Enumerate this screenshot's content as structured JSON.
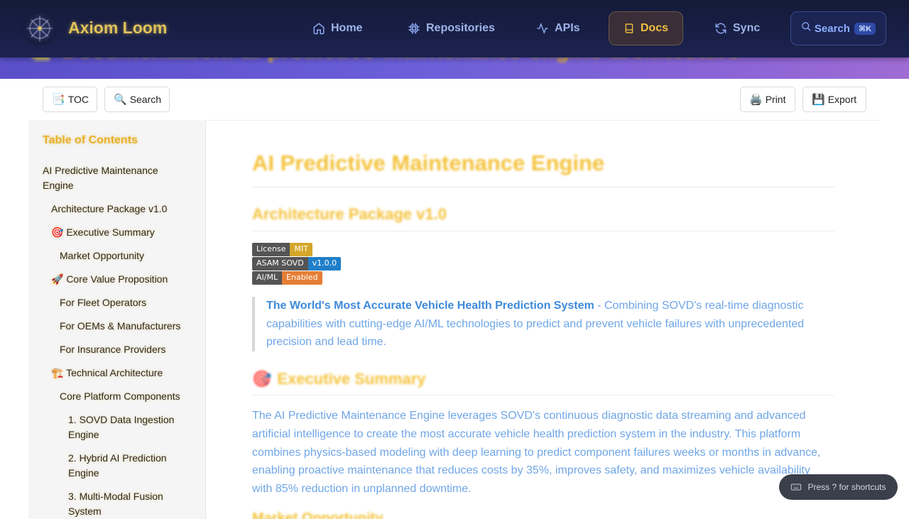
{
  "banner": {
    "title": "Documentation: ai-predictive-maintenance-engine-architecture",
    "emoji": "📒"
  },
  "nav": {
    "brand": "Axiom Loom",
    "items": [
      {
        "label": "Home",
        "icon": "home-icon"
      },
      {
        "label": "Repositories",
        "icon": "chip-icon"
      },
      {
        "label": "APIs",
        "icon": "activity-icon"
      },
      {
        "label": "Docs",
        "icon": "book-icon",
        "active": true
      },
      {
        "label": "Sync",
        "icon": "refresh-icon"
      }
    ],
    "search_label": "Search",
    "search_kbd": "⌘K"
  },
  "toolbar": {
    "toc": {
      "icon": "📑",
      "label": "TOC"
    },
    "search": {
      "icon": "🔍",
      "label": "Search"
    },
    "print": {
      "icon": "🖨️",
      "label": "Print"
    },
    "export": {
      "icon": "💾",
      "label": "Export"
    }
  },
  "toc": {
    "title": "Table of Contents",
    "items": [
      "AI Predictive Maintenance Engine",
      "Architecture Package v1.0",
      "🎯 Executive Summary",
      "Market Opportunity",
      "🚀 Core Value Proposition",
      "For Fleet Operators",
      "For OEMs & Manufacturers",
      "For Insurance Providers",
      "🏗️ Technical Architecture",
      "Core Platform Components",
      "1. SOVD Data Ingestion Engine",
      "2. Hybrid AI Prediction Engine",
      "3. Multi-Modal Fusion System"
    ]
  },
  "content": {
    "h1": "AI Predictive Maintenance Engine",
    "h2_package": "Architecture Package v1.0",
    "badges": [
      {
        "key": "License",
        "value": "MIT",
        "color": "#d4a62a"
      },
      {
        "key": "ASAM SOVD",
        "value": "v1.0.0",
        "color": "#1f7fc9"
      },
      {
        "key": "AI/ML",
        "value": "Enabled",
        "color": "#e67e35"
      }
    ],
    "quote_bold": "The World's Most Accurate Vehicle Health Prediction System",
    "quote_rest": " - Combining SOVD's real-time diagnostic capabilities with cutting-edge AI/ML technologies to predict and prevent vehicle failures with unprecedented precision and lead time.",
    "h2_exec_emoji": "🎯",
    "h2_exec": "Executive Summary",
    "exec_paragraph": "The AI Predictive Maintenance Engine leverages SOVD's continuous diagnostic data streaming and advanced artificial intelligence to create the most accurate vehicle health prediction system in the industry. This platform combines physics-based modeling with deep learning to predict component failures weeks or months in advance, enabling proactive maintenance that reduces costs by 35%, improves safety, and maximizes vehicle availability with 85% reduction in unplanned downtime.",
    "h3_next": "Market Opportunity"
  },
  "shortcut_hint": "Press ? for shortcuts"
}
